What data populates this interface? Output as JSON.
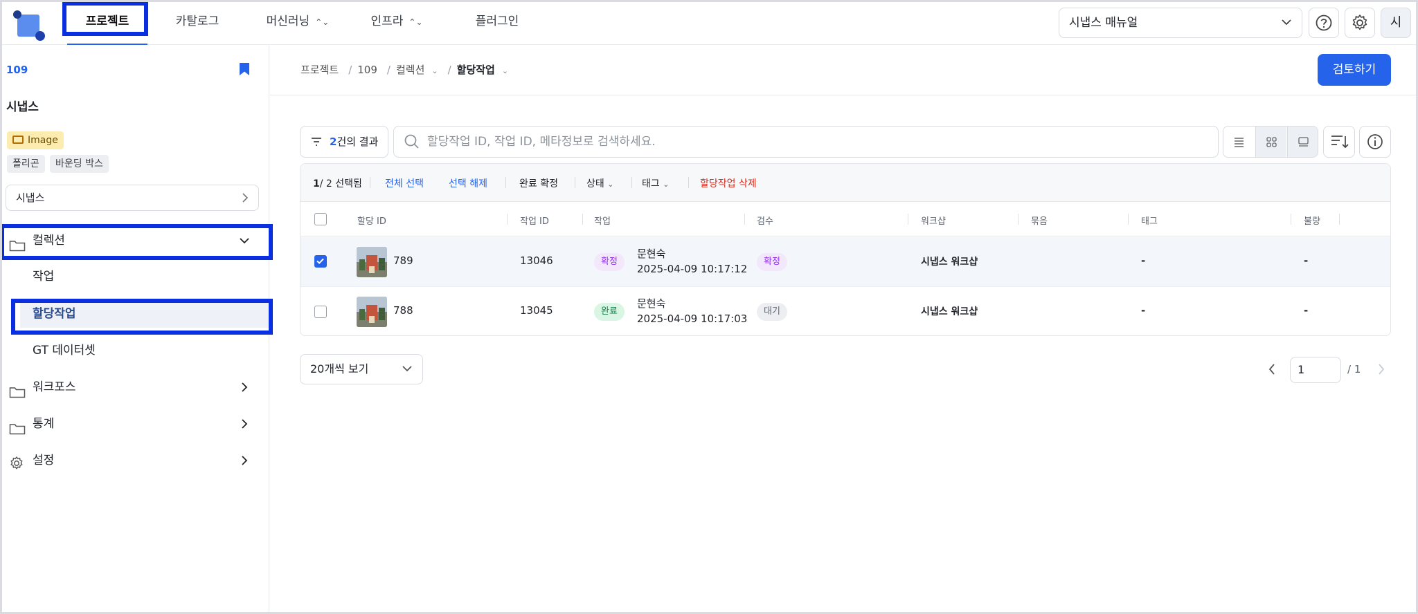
{
  "nav": {
    "tabs": [
      {
        "label": "프로젝트",
        "active": true
      },
      {
        "label": "카탈로그"
      },
      {
        "label": "머신러닝"
      },
      {
        "label": "인프라"
      },
      {
        "label": "플러그인"
      }
    ],
    "manual_select": "시냅스 매뉴얼",
    "user_initial": "시"
  },
  "sidebar": {
    "project_id": "109",
    "project_name": "시냅스",
    "data_type_badge": "Image",
    "annotation_tags": [
      "폴리곤",
      "바운딩 박스"
    ],
    "workspace": "시냅스",
    "menu": {
      "collection": "컬렉션",
      "sub_items": [
        "작업",
        "할당작업",
        "GT 데이터셋"
      ],
      "workforce": "워크포스",
      "stats": "통계",
      "settings": "설정"
    }
  },
  "breadcrumb": [
    "프로젝트",
    "109",
    "컬렉션",
    "할당작업"
  ],
  "review_button": "검토하기",
  "toolbar": {
    "result_count": "2",
    "result_suffix": "건의 결과",
    "search_placeholder": "할당작업 ID, 작업 ID, 메타정보로 검색하세요."
  },
  "actions": {
    "selected_count": "1",
    "total_count": "/ 2",
    "selected_suffix": "선택됨",
    "select_all": "전체 선택",
    "deselect": "선택 해제",
    "confirm_complete": "완료 확정",
    "status": "상태",
    "tag": "태그",
    "delete": "할당작업 삭제"
  },
  "table": {
    "columns": [
      "할당 ID",
      "작업 ID",
      "작업",
      "검수",
      "워크샵",
      "묶음",
      "태그",
      "불량"
    ],
    "rows": [
      {
        "selected": true,
        "assign_id": "789",
        "task_id": "13046",
        "status": "확정",
        "worker": "문현숙",
        "time": "2025-04-09 10:17:12",
        "review": "확정",
        "workshop": "시냅스 워크샵",
        "tag": "-",
        "defect": "-"
      },
      {
        "selected": false,
        "assign_id": "788",
        "task_id": "13045",
        "status": "완료",
        "worker": "문현숙",
        "time": "2025-04-09 10:17:03",
        "review": "대기",
        "workshop": "시냅스 워크샵",
        "tag": "-",
        "defect": "-"
      }
    ]
  },
  "pagination": {
    "page_size": "20개씩 보기",
    "current_page": "1",
    "total_pages": "/ 1"
  },
  "colors": {
    "accent": "#2563eb",
    "highlight": "#0a2fe0",
    "danger": "#d92d20"
  }
}
